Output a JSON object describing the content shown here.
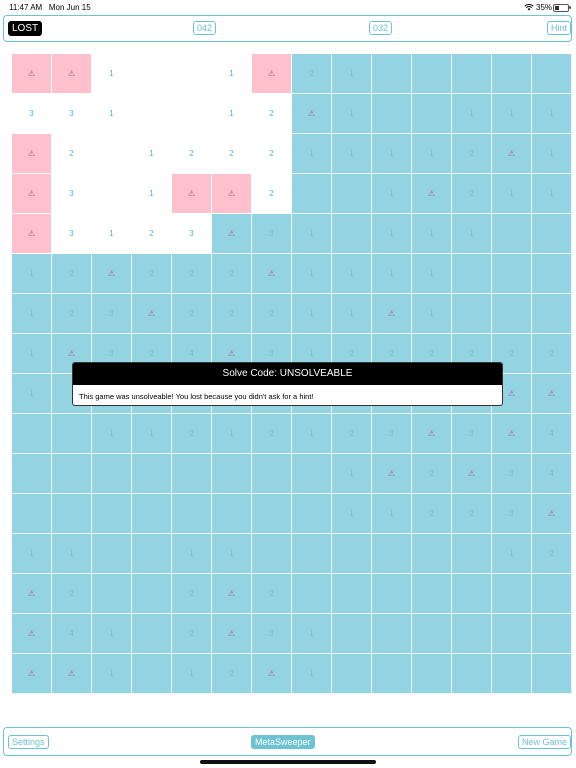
{
  "status_bar": {
    "time": "11:47 AM",
    "date": "Mon Jun 15",
    "battery": "35%",
    "battery_level": 0.35,
    "wifi_icon": "wifi-icon",
    "battery_icon": "battery-icon"
  },
  "toolbar": {
    "status_label": "LOST",
    "left_counter": "042",
    "right_counter": "032",
    "hint_label": "Hint"
  },
  "bottom_bar": {
    "settings_label": "Settings",
    "app_title": "MetaSweeper",
    "new_game_label": "New Game"
  },
  "dialog": {
    "title": "Solve Code: UNSOLVEABLE",
    "message": "This game was unsolveable! You lost because you didn't ask for a hint!"
  },
  "board": {
    "cols": 14,
    "rows": 16,
    "mine_symbol": "⚠",
    "legend": {
      "c": "covered",
      "o": "opened",
      "m": "mine-revealed",
      "f": "flagged"
    },
    "cells": [
      [
        "m:",
        "m:",
        "o:1",
        "o:",
        "o:",
        "o:1",
        "m:",
        "c:2",
        "c:1",
        "c:",
        "c:",
        "c:",
        "c:",
        "c:"
      ],
      [
        "o:3",
        "o:3",
        "o:1",
        "o:",
        "o:",
        "o:1",
        "o:2",
        "f:",
        "c:1",
        "c:",
        "c:",
        "c:1",
        "c:1",
        "c:1"
      ],
      [
        "m:",
        "o:2",
        "o:",
        "o:1",
        "o:2",
        "o:2",
        "o:2",
        "c:1",
        "c:1",
        "c:1",
        "c:1",
        "c:2",
        "f:",
        "c:1"
      ],
      [
        "m:",
        "o:3",
        "o:",
        "o:1",
        "m:",
        "m:",
        "o:2",
        "c:",
        "c:",
        "c:1",
        "f:",
        "c:2",
        "c:1",
        "c:1"
      ],
      [
        "m:",
        "o:3",
        "o:1",
        "o:2",
        "o:3",
        "f:",
        "c:3",
        "c:1",
        "c:",
        "c:1",
        "c:1",
        "c:1",
        "c:",
        "c:"
      ],
      [
        "c:1",
        "c:2",
        "f:",
        "c:2",
        "c:2",
        "c:2",
        "f:",
        "c:1",
        "c:1",
        "c:1",
        "c:1",
        "c:",
        "c:",
        "c:"
      ],
      [
        "c:1",
        "c:2",
        "c:3",
        "f:",
        "c:2",
        "c:2",
        "c:2",
        "c:1",
        "c:1",
        "f:",
        "c:1",
        "c:",
        "c:",
        "c:"
      ],
      [
        "c:1",
        "f:",
        "c:3",
        "c:2",
        "c:4",
        "f:",
        "c:3",
        "c:1",
        "c:2",
        "c:2",
        "c:2",
        "c:2",
        "c:2",
        "c:2"
      ],
      [
        "c:1",
        "c:",
        "c:",
        "c:",
        "c:",
        "c:",
        "c:",
        "c:",
        "c:",
        "c:",
        "c:",
        "c:",
        "f:",
        "f:"
      ],
      [
        "c:",
        "c:",
        "c:1",
        "c:1",
        "c:2",
        "c:1",
        "c:2",
        "c:1",
        "c:2",
        "c:3",
        "f:",
        "c:3",
        "f:",
        "c:4"
      ],
      [
        "c:",
        "c:",
        "c:",
        "c:",
        "c:",
        "c:",
        "c:",
        "c:",
        "c:1",
        "f:",
        "c:2",
        "f:",
        "c:3",
        "c:4"
      ],
      [
        "c:",
        "c:",
        "c:",
        "c:",
        "c:",
        "c:",
        "c:",
        "c:",
        "c:1",
        "c:1",
        "c:2",
        "c:2",
        "c:3",
        "f:"
      ],
      [
        "c:1",
        "c:1",
        "c:",
        "c:",
        "c:1",
        "c:1",
        "c:",
        "c:",
        "c:",
        "c:",
        "c:",
        "c:",
        "c:1",
        "c:2"
      ],
      [
        "f:",
        "c:2",
        "c:",
        "c:",
        "c:2",
        "f:",
        "c:2",
        "c:",
        "c:",
        "c:",
        "c:",
        "c:",
        "c:",
        "c:"
      ],
      [
        "f:",
        "c:4",
        "c:1",
        "c:",
        "c:2",
        "f:",
        "c:3",
        "c:1",
        "c:",
        "c:",
        "c:",
        "c:",
        "c:",
        "c:"
      ],
      [
        "f:",
        "f:",
        "c:1",
        "c:",
        "c:1",
        "c:2",
        "f:",
        "c:1",
        "c:",
        "c:",
        "c:",
        "c:",
        "c:",
        "c:"
      ]
    ]
  }
}
